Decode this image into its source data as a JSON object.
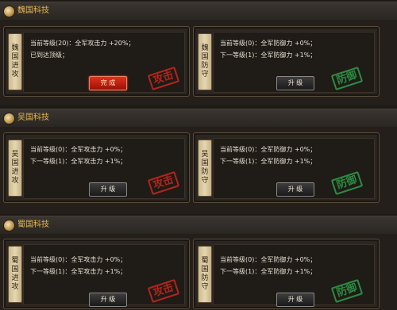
{
  "sections": [
    {
      "title": "魏国科技",
      "attack": {
        "label": "魏国进攻",
        "line1": "当前等级(20)：全军攻击力 +20%；",
        "line2": "已到达顶级；",
        "button": "完 成",
        "stamp": "攻击"
      },
      "defense": {
        "label": "魏国防守",
        "line1": "当前等级(0)：全军防御力 +0%；",
        "line2": "下一等级(1)：全军防御力 +1%；",
        "button": "升 级",
        "stamp": "防御"
      }
    },
    {
      "title": "吴国科技",
      "attack": {
        "label": "吴国进攻",
        "line1": "当前等级(0)：全军攻击力 +0%；",
        "line2": "下一等级(1)：全军攻击力 +1%；",
        "button": "升 级",
        "stamp": "攻击"
      },
      "defense": {
        "label": "吴国防守",
        "line1": "当前等级(0)：全军防御力 +0%；",
        "line2": "下一等级(1)：全军防御力 +1%；",
        "button": "升 级",
        "stamp": "防御"
      }
    },
    {
      "title": "蜀国科技",
      "attack": {
        "label": "蜀国进攻",
        "line1": "当前等级(0)：全军攻击力 +0%；",
        "line2": "下一等级(1)：全军攻击力 +1%；",
        "button": "升 级",
        "stamp": "攻击"
      },
      "defense": {
        "label": "蜀国防守",
        "line1": "当前等级(0)：全军防御力 +0%；",
        "line2": "下一等级(1)：全军防御力 +1%；",
        "button": "升 级",
        "stamp": "防御"
      }
    }
  ],
  "colors": {
    "header_text": "#e8b84a",
    "attack_stamp": "#d0281e",
    "defense_stamp": "#2ea44a",
    "done_button": "#d02010"
  },
  "icons": [
    "medal-icon"
  ]
}
